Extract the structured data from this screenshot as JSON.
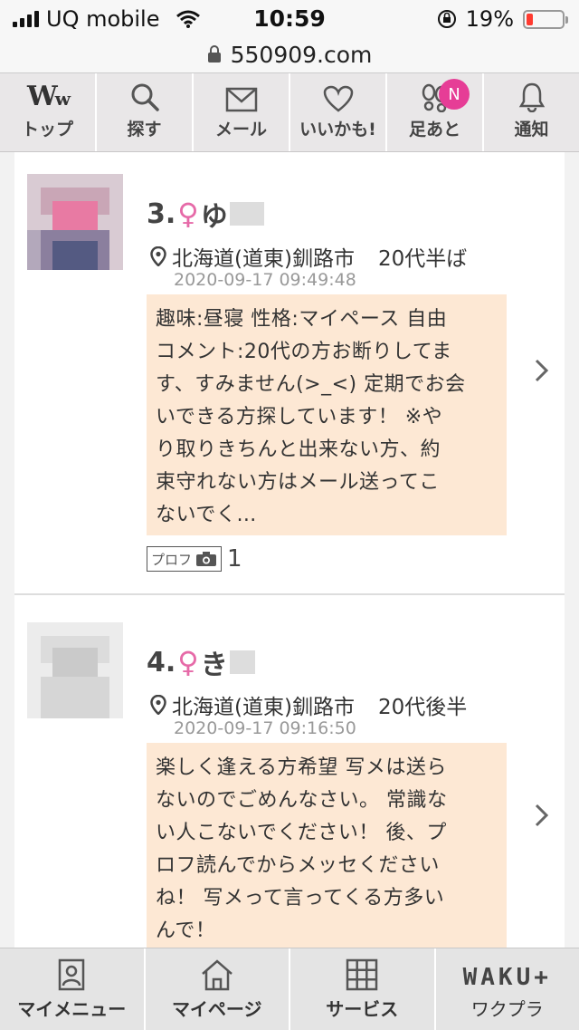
{
  "status_bar": {
    "carrier": "UQ mobile",
    "time": "10:59",
    "battery_percent": "19%",
    "battery_level": 0.19
  },
  "url_bar": {
    "url": "550909.com"
  },
  "nav": {
    "items": [
      {
        "label": "トップ",
        "icon": "ww-logo"
      },
      {
        "label": "探す",
        "icon": "search-icon"
      },
      {
        "label": "メール",
        "icon": "mail-icon"
      },
      {
        "label": "いいかも!",
        "icon": "heart-icon"
      },
      {
        "label": "足あと",
        "icon": "footprints-icon",
        "badge": "N"
      },
      {
        "label": "通知",
        "icon": "bell-icon"
      }
    ]
  },
  "posts": [
    {
      "rank": "3.",
      "gender_symbol": "♀",
      "name_initial": "ゆ",
      "location": "北海道(道東)釧路市",
      "age": "20代半ば",
      "timestamp": "2020-09-17 09:49:48",
      "message_lines": [
        "趣味:昼寝 性格:マイペース 自由",
        "コメント:20代の方お断りしてま",
        "す、すみません(>_<) 定期でお会",
        "いできる方探しています！ ※や",
        "り取りきちんと出来ない方、約",
        "束守れない方はメール送ってこ",
        "ないでく…"
      ],
      "profile_label": "プロフ",
      "photo_count": "1"
    },
    {
      "rank": "4.",
      "gender_symbol": "♀",
      "name_initial": "き",
      "location": "北海道(道東)釧路市",
      "age": "20代後半",
      "timestamp": "2020-09-17 09:16:50",
      "message_lines": [
        "楽しく逢える方希望 写メは送ら",
        "ないのでごめんなさい。 常識な",
        "い人こないでください！ 後、プ",
        "ロフ読んでからメッセください",
        "ね！ 写メって言ってくる方多い",
        "んで！"
      ]
    }
  ],
  "bottom_bar": {
    "items": [
      {
        "label": "マイメニュー",
        "icon": "profile-card-icon"
      },
      {
        "label": "マイページ",
        "icon": "home-icon"
      },
      {
        "label": "サービス",
        "icon": "grid-icon"
      },
      {
        "label": "ワクプラ",
        "logo": "WAKU+"
      }
    ]
  },
  "colors": {
    "accent_pink": "#e63d96",
    "female_symbol": "#e66aa8",
    "message_bg": "#fde8d4",
    "nav_bg": "#e9e7e8"
  }
}
